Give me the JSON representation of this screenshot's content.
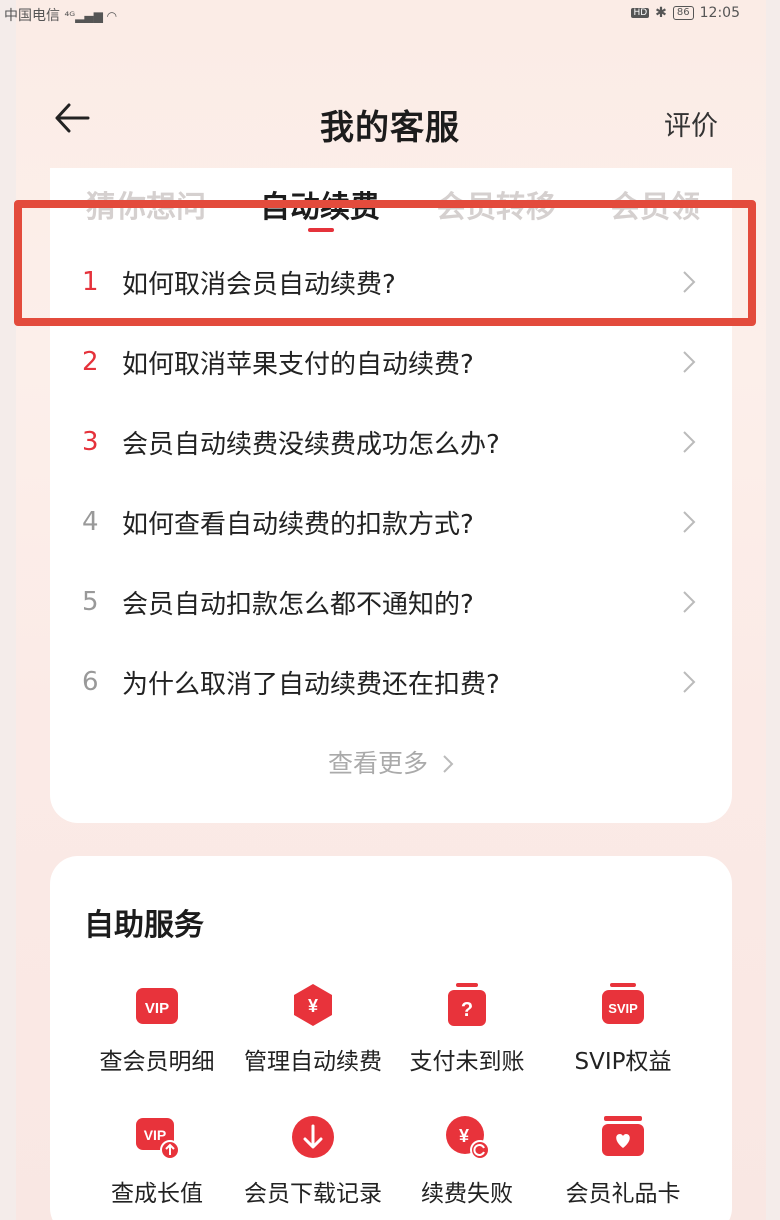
{
  "status_bar": {
    "carrier": "中国电信",
    "signal": "⁴ᴳ.ıll ",
    "battery": "86",
    "time": "12:05",
    "hd": "HD"
  },
  "header": {
    "title": "我的客服",
    "rate_label": "评价"
  },
  "tabs": [
    {
      "label": "猜你想问",
      "active": false
    },
    {
      "label": "自动续费",
      "active": true
    },
    {
      "label": "会员转移",
      "active": false
    },
    {
      "label": "会员领",
      "active": false
    }
  ],
  "questions": [
    {
      "num": "1",
      "text": "如何取消会员自动续费?",
      "hot": true
    },
    {
      "num": "2",
      "text": "如何取消苹果支付的自动续费?",
      "hot": true
    },
    {
      "num": "3",
      "text": "会员自动续费没续费成功怎么办?",
      "hot": true
    },
    {
      "num": "4",
      "text": "如何查看自动续费的扣款方式?",
      "hot": false
    },
    {
      "num": "5",
      "text": "会员自动扣款怎么都不通知的?",
      "hot": false
    },
    {
      "num": "6",
      "text": "为什么取消了自动续费还在扣费?",
      "hot": false
    }
  ],
  "see_more": "查看更多",
  "self_service": {
    "title": "自助服务",
    "items": [
      {
        "label": "查会员明细",
        "icon": "vip-icon"
      },
      {
        "label": "管理自动续费",
        "icon": "yuan-hexagon-icon"
      },
      {
        "label": "支付未到账",
        "icon": "question-card-icon"
      },
      {
        "label": "SVIP权益",
        "icon": "svip-icon"
      },
      {
        "label": "查成长值",
        "icon": "vip-growth-icon"
      },
      {
        "label": "会员下载记录",
        "icon": "download-icon"
      },
      {
        "label": "续费失败",
        "icon": "yuan-refresh-icon"
      },
      {
        "label": "会员礼品卡",
        "icon": "gift-card-icon"
      }
    ]
  },
  "colors": {
    "accent": "#e5323b",
    "highlight": "#e34b3c"
  }
}
